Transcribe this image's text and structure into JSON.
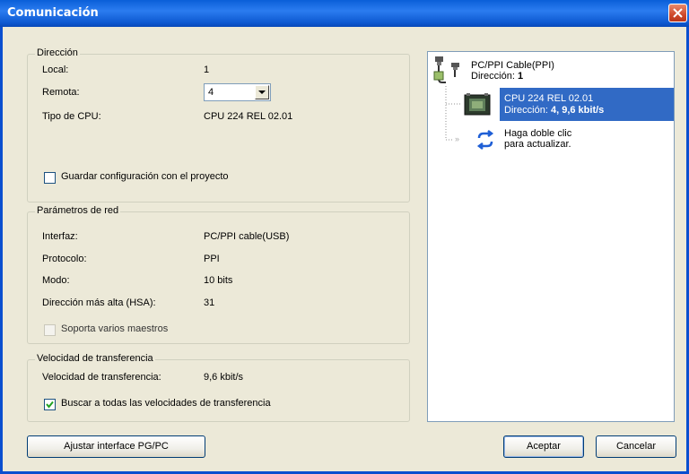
{
  "window": {
    "title": "Comunicación"
  },
  "direccion": {
    "legend": "Dirección",
    "local_label": "Local:",
    "local_value": "1",
    "remota_label": "Remota:",
    "remota_value": "4",
    "tipo_label": "Tipo de CPU:",
    "tipo_value": "CPU 224 REL 02.01",
    "guardar_label": "Guardar configuración con el proyecto",
    "guardar_checked": false
  },
  "red": {
    "legend": "Parámetros de red",
    "interfaz_label": "Interfaz:",
    "interfaz_value": "PC/PPI cable(USB)",
    "protocolo_label": "Protocolo:",
    "protocolo_value": "PPI",
    "modo_label": "Modo:",
    "modo_value": "10 bits",
    "hsa_label": "Dirección más alta (HSA):",
    "hsa_value": "31",
    "maestros_label": "Soporta varios maestros",
    "maestros_checked": false
  },
  "transfer": {
    "legend": "Velocidad de transferencia",
    "velocidad_label": "Velocidad de transferencia:",
    "velocidad_value": "9,6 kbit/s",
    "buscar_label": "Buscar a todas las velocidades de transferencia",
    "buscar_checked": true
  },
  "tree": {
    "cable_name": "PC/PPI Cable(PPI)",
    "cable_addr_prefix": "Dirección: ",
    "cable_addr_value": "1",
    "cpu_name": "CPU 224 REL 02.01",
    "cpu_addr_prefix": "Dirección: ",
    "cpu_addr_value": "4, 9,6 kbit/s",
    "refresh_line1": "Haga doble clic",
    "refresh_line2": "para actualizar."
  },
  "buttons": {
    "ajustar": "Ajustar interface PG/PC",
    "aceptar": "Aceptar",
    "cancelar": "Cancelar"
  },
  "colors": {
    "titlebar": "#0a5fd8",
    "selection": "#316ac5",
    "dialog": "#ece9d8"
  },
  "icons": [
    "close-icon",
    "cable-icon",
    "cpu-icon",
    "refresh-icon",
    "dropdown-arrow-icon",
    "checkmark-icon"
  ]
}
